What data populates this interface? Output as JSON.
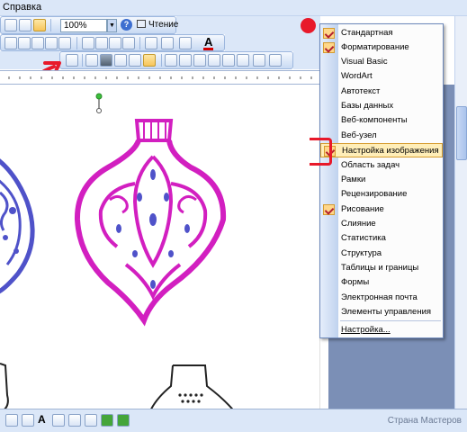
{
  "menu": {
    "help": "Справка"
  },
  "toolbar": {
    "zoom_value": "100%",
    "read_label": "Чтение",
    "help_symbol": "?"
  },
  "popup": {
    "items": [
      {
        "label": "Стандартная",
        "checked": true
      },
      {
        "label": "Форматирование",
        "checked": true
      },
      {
        "label": "Visual Basic",
        "checked": false
      },
      {
        "label": "WordArt",
        "checked": false
      },
      {
        "label": "Автотекст",
        "checked": false
      },
      {
        "label": "Базы данных",
        "checked": false
      },
      {
        "label": "Веб-компоненты",
        "checked": false
      },
      {
        "label": "Веб-узел",
        "checked": false
      },
      {
        "label": "Настройка изображения",
        "checked": true,
        "highlighted": true
      },
      {
        "label": "Область задач",
        "checked": false
      },
      {
        "label": "Рамки",
        "checked": false
      },
      {
        "label": "Рецензирование",
        "checked": false
      },
      {
        "label": "Рисование",
        "checked": true
      },
      {
        "label": "Слияние",
        "checked": false
      },
      {
        "label": "Статистика",
        "checked": false
      },
      {
        "label": "Структура",
        "checked": false
      },
      {
        "label": "Таблицы и границы",
        "checked": false
      },
      {
        "label": "Формы",
        "checked": false
      },
      {
        "label": "Электронная почта",
        "checked": false
      },
      {
        "label": "Элементы управления",
        "checked": false
      }
    ],
    "customize": "Настройка..."
  },
  "watermark": "Страна Мастеров",
  "colors": {
    "ornament_right": "#d21fc0",
    "ornament_left": "#4f52c9",
    "annotation_red": "#e8192a",
    "desktop": "#7b8fb6"
  }
}
